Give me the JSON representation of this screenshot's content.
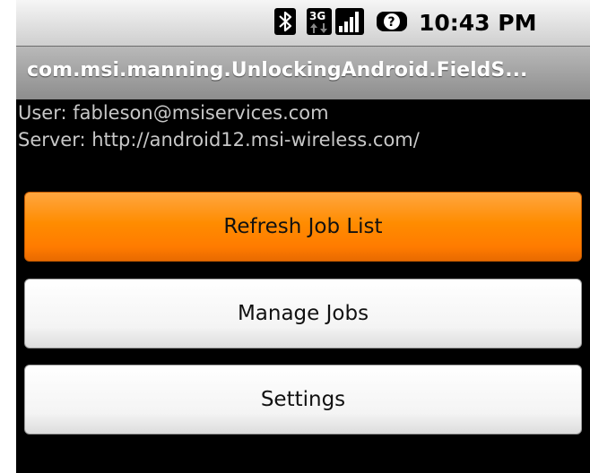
{
  "status_bar": {
    "time": "10:43 PM",
    "icons": [
      "bluetooth-icon",
      "3g-data-icon",
      "signal-strength-icon",
      "unknown-sim-icon"
    ]
  },
  "app": {
    "title": "com.msi.manning.UnlockingAndroid.FieldS..."
  },
  "info": {
    "user": "User: fableson@msiservices.com",
    "server": "Server: http://android12.msi-wireless.com/"
  },
  "buttons": {
    "refresh": "Refresh Job List",
    "manage": "Manage Jobs",
    "settings": "Settings"
  },
  "colors": {
    "focused_button": "#ff8c00",
    "button": "#ffffff",
    "background": "#000000"
  }
}
